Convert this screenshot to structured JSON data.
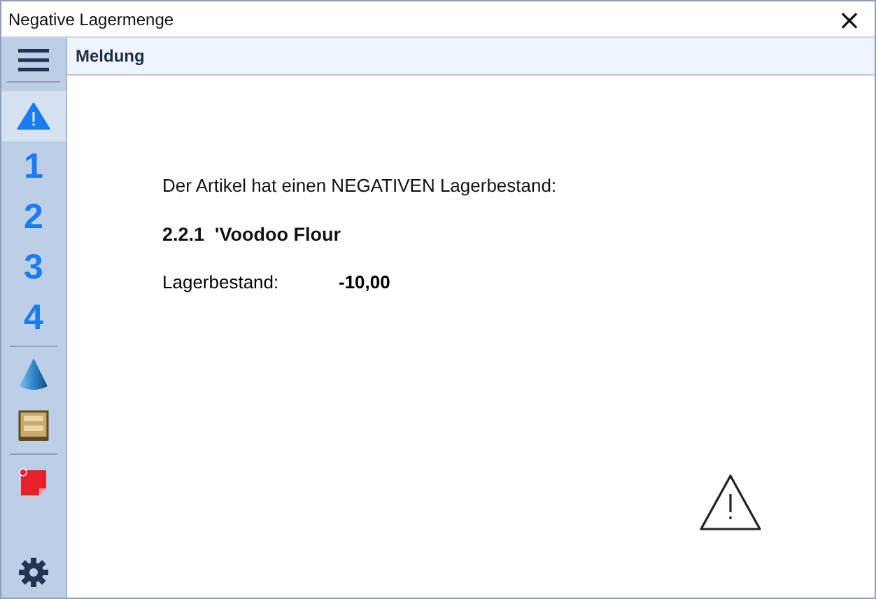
{
  "window": {
    "title": "Negative Lagermenge",
    "close": "×"
  },
  "sidebar": {
    "items": [
      {
        "kind": "menu",
        "selected": false
      },
      {
        "kind": "alert",
        "selected": true
      },
      {
        "kind": "digit",
        "label": "1",
        "selected": false
      },
      {
        "kind": "digit",
        "label": "2",
        "selected": false
      },
      {
        "kind": "digit",
        "label": "3",
        "selected": false
      },
      {
        "kind": "digit",
        "label": "4",
        "selected": false
      },
      {
        "kind": "separator"
      },
      {
        "kind": "cone",
        "selected": false
      },
      {
        "kind": "shelf",
        "selected": false
      },
      {
        "kind": "separator"
      },
      {
        "kind": "note",
        "selected": false
      },
      {
        "kind": "gear",
        "selected": false
      }
    ]
  },
  "panel": {
    "header": "Meldung",
    "intro": "Der Artikel hat einen NEGATIVEN Lagerbestand:",
    "article": "2.2.1  'Voodoo Flour",
    "stock_label": "Lagerbestand:",
    "stock_value": "-10,00"
  }
}
